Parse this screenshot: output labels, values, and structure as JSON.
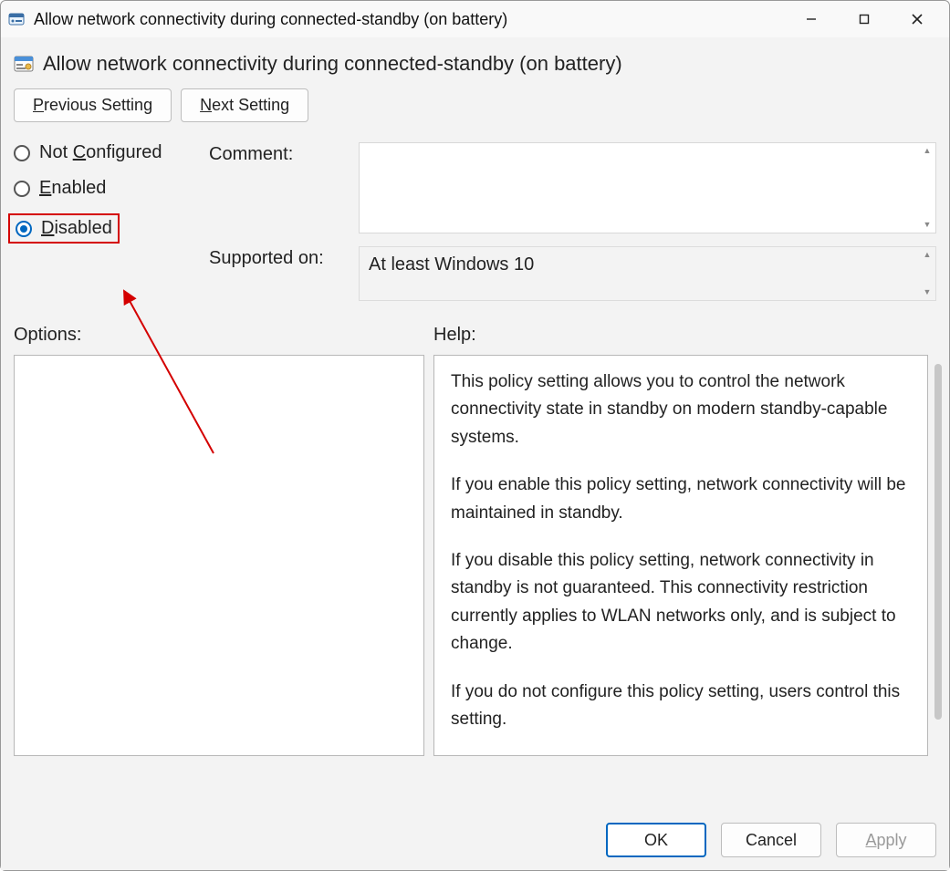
{
  "title": "Allow network connectivity during connected-standby (on battery)",
  "header": "Allow network connectivity during connected-standby (on battery)",
  "nav": {
    "prev": "Previous Setting",
    "next": "Next Setting"
  },
  "radios": {
    "not_configured": "Not Configured",
    "enabled": "Enabled",
    "disabled": "Disabled",
    "selected": "disabled"
  },
  "fields": {
    "comment_label": "Comment:",
    "comment_value": "",
    "supported_label": "Supported on:",
    "supported_value": "At least Windows 10"
  },
  "panes": {
    "options_label": "Options:",
    "help_label": "Help:"
  },
  "help_paragraphs": [
    "This policy setting allows you to control the network connectivity state in standby on modern standby-capable systems.",
    "If you enable this policy setting, network connectivity will be maintained in standby.",
    "If you disable this policy setting, network connectivity in standby is not guaranteed. This connectivity restriction currently applies to WLAN networks only, and is subject to change.",
    "If you do not configure this policy setting, users control this setting."
  ],
  "footer": {
    "ok": "OK",
    "cancel": "Cancel",
    "apply": "Apply"
  },
  "annotation": {
    "color": "#d40000"
  }
}
